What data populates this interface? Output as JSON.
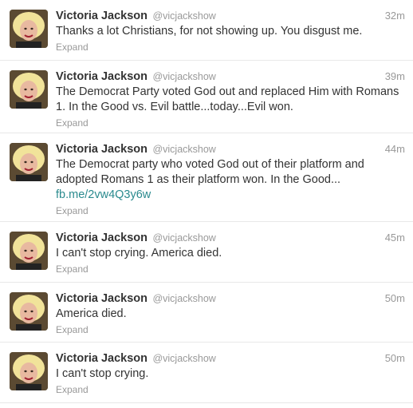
{
  "tweets": [
    {
      "fullname": "Victoria Jackson",
      "username": "@vicjackshow",
      "time": "32m",
      "text": "Thanks a lot Christians, for not showing up. You disgust me.",
      "link": "",
      "expand": "Expand"
    },
    {
      "fullname": "Victoria Jackson",
      "username": "@vicjackshow",
      "time": "39m",
      "text": "The Democrat Party voted God out and replaced Him with Romans 1. In the Good vs. Evil battle...today...Evil won.",
      "link": "",
      "expand": "Expand"
    },
    {
      "fullname": "Victoria Jackson",
      "username": "@vicjackshow",
      "time": "44m",
      "text": "The Democrat party who voted God out of their platform and adopted Romans 1 as their platform won. In the Good...",
      "link": "fb.me/2vw4Q3y6w",
      "expand": "Expand"
    },
    {
      "fullname": "Victoria Jackson",
      "username": "@vicjackshow",
      "time": "45m",
      "text": "I can't stop crying. America died.",
      "link": "",
      "expand": "Expand"
    },
    {
      "fullname": "Victoria Jackson",
      "username": "@vicjackshow",
      "time": "50m",
      "text": "America died.",
      "link": "",
      "expand": "Expand"
    },
    {
      "fullname": "Victoria Jackson",
      "username": "@vicjackshow",
      "time": "50m",
      "text": "I can't stop crying.",
      "link": "",
      "expand": "Expand"
    }
  ],
  "colors": {
    "name": "#333333",
    "muted": "#999999",
    "link": "#2a8a8e",
    "divider": "#e8e8e8"
  }
}
